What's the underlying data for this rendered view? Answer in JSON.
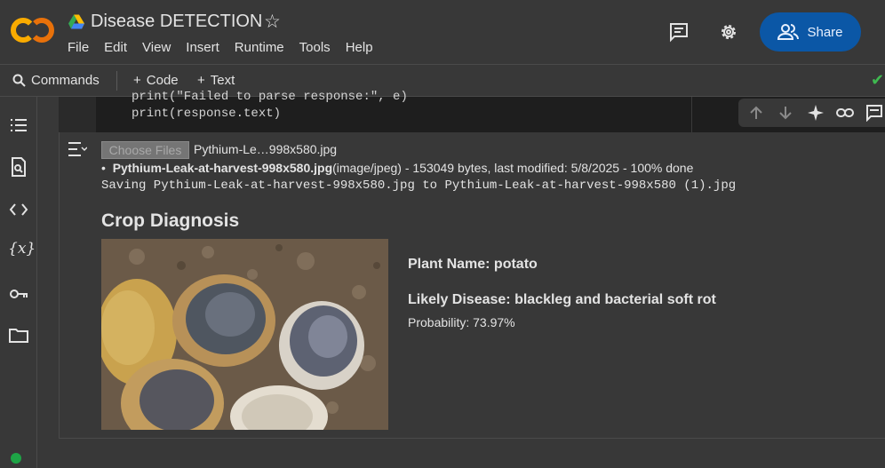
{
  "header": {
    "title": "Disease DETECTION",
    "menu": [
      "File",
      "Edit",
      "View",
      "Insert",
      "Runtime",
      "Tools",
      "Help"
    ],
    "share_label": "Share"
  },
  "toolbar": {
    "commands_label": "Commands",
    "add_code_label": "Code",
    "add_text_label": "Text"
  },
  "cell": {
    "code_lines": [
      "print(\"Failed to parse response:\", e)",
      "print(response.text)"
    ]
  },
  "output": {
    "choose_files_label": "Choose Files",
    "chosen_file": "Pythium-Le…998x580.jpg",
    "upload_filename": "Pythium-Leak-at-harvest-998x580.jpg",
    "upload_details": "(image/jpeg) - 153049 bytes, last modified: 5/8/2025 - 100% done",
    "saving_line": "Saving Pythium-Leak-at-harvest-998x580.jpg to Pythium-Leak-at-harvest-998x580 (1).jpg",
    "heading": "Crop Diagnosis",
    "plant_name": "Plant Name: potato",
    "likely_disease": "Likely Disease: blackleg and bacterial soft rot",
    "probability": "Probability: 73.97%"
  },
  "colors": {
    "background": "#383838",
    "code_bg": "#1e1e1e",
    "share_bg": "#0b57a6",
    "logo_orange": "#f9ab00",
    "logo_red": "#e8710a",
    "status_green": "#1ea446"
  },
  "icons": [
    "colab-logo",
    "drive-icon",
    "star-icon",
    "comment-icon",
    "gear-icon",
    "people-icon",
    "search-icon",
    "plus-icon",
    "check-icon",
    "toc-icon",
    "find-icon",
    "code-icon",
    "variables-icon",
    "key-icon",
    "folder-icon",
    "output-icon",
    "arrow-up-icon",
    "arrow-down-icon",
    "sparkle-icon",
    "link-icon",
    "comment-icon"
  ]
}
